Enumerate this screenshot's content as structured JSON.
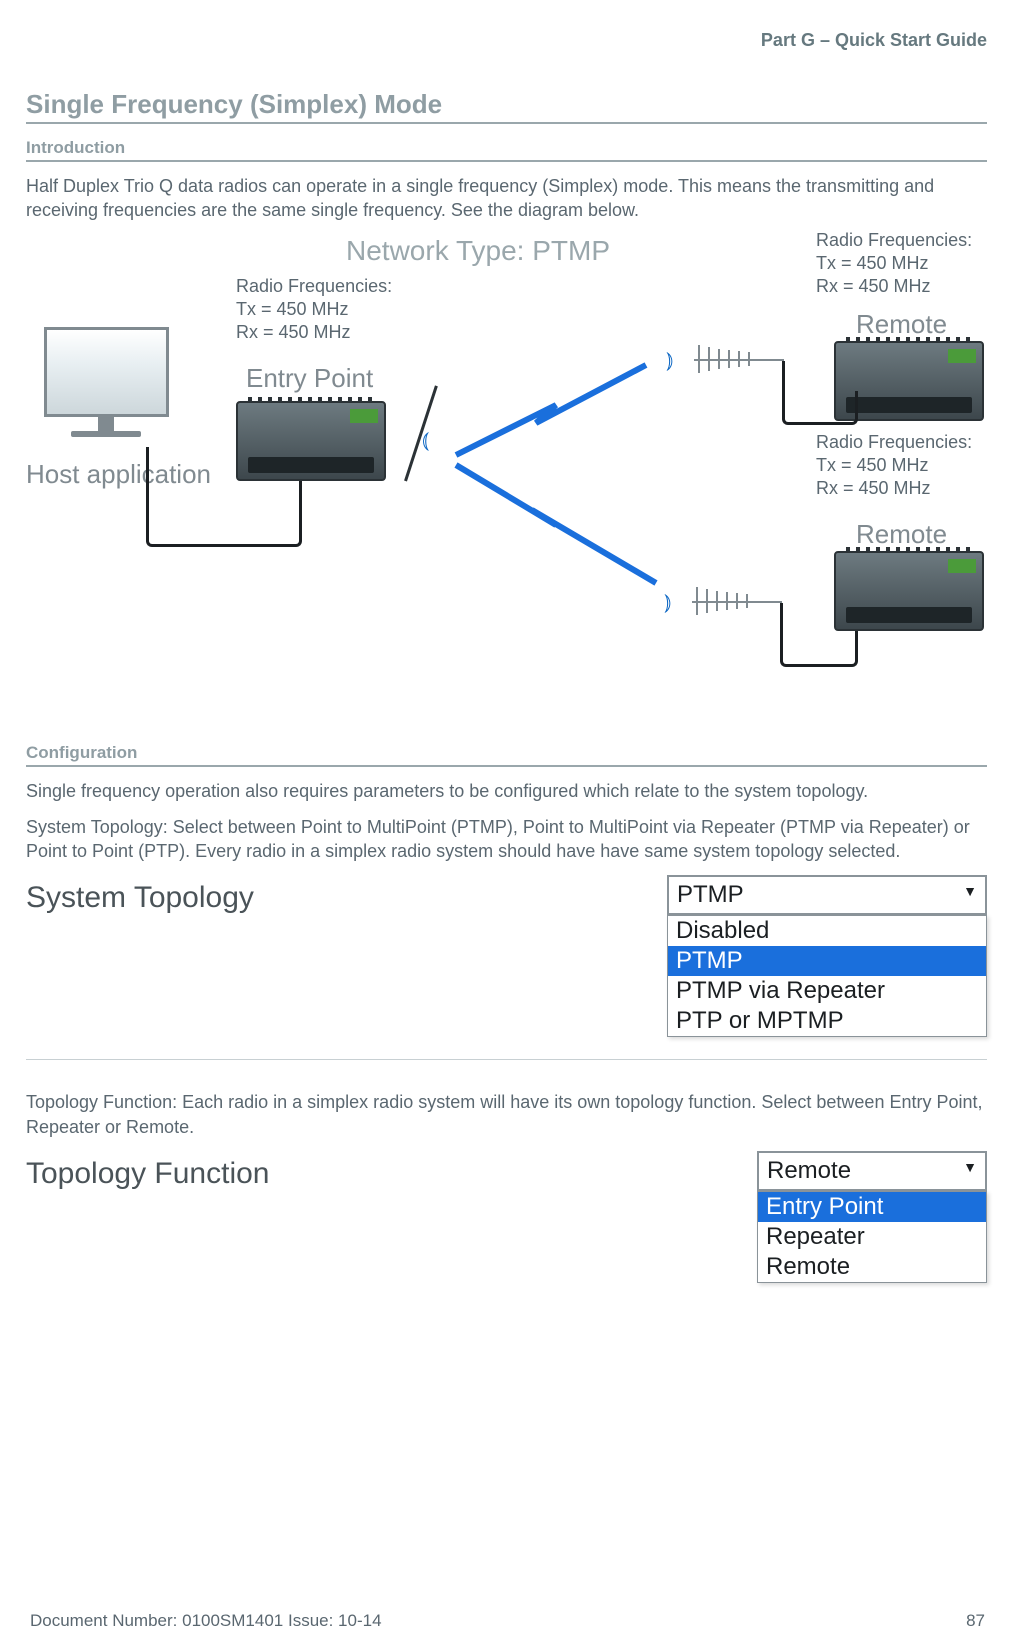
{
  "header": {
    "part": "Part G – Quick Start Guide"
  },
  "title": "Single Frequency (Simplex) Mode",
  "intro": {
    "heading": "Introduction",
    "body": "Half Duplex Trio Q data radios can operate in a single frequency (Simplex) mode. This means the transmitting and receiving frequencies are the same single frequency. See the diagram below."
  },
  "diagram": {
    "network_type": "Network Type: PTMP",
    "host_label": "Host application",
    "entry_label": "Entry Point",
    "remote_label": "Remote",
    "freq_block": "Radio Frequencies:\nTx = 450 MHz\nRx = 450 MHz"
  },
  "config": {
    "heading": "Configuration",
    "p1": "Single frequency operation also requires parameters to be configured which relate to the system topology.",
    "p2": "System Topology: Select between Point to MultiPoint (PTMP), Point to MultiPoint via Repeater (PTMP via Repeater) or Point to Point (PTP). Every radio in a simplex radio system should have have same system topology selected.",
    "p3": "Topology Function: Each radio in a simplex radio system will have its own topology function. Select between Entry Point, Repeater or Remote."
  },
  "system_topology": {
    "label": "System Topology",
    "selected": "PTMP",
    "options": [
      "Disabled",
      "PTMP",
      "PTMP via Repeater",
      "PTP or MPTMP"
    ]
  },
  "topology_function": {
    "label": "Topology Function",
    "selected": "Remote",
    "options": [
      "Entry Point",
      "Repeater",
      "Remote"
    ]
  },
  "footer": {
    "doc": "Document Number: 0100SM1401   Issue: 10-14",
    "page": "87"
  }
}
